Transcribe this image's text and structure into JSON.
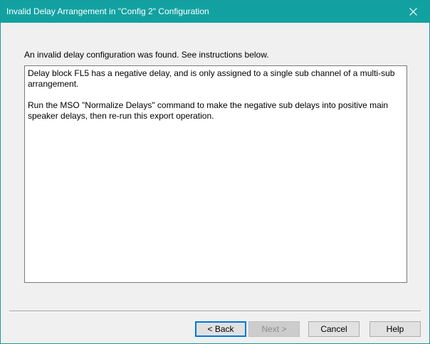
{
  "window": {
    "title": "Invalid Delay Arrangement in \"Config 2\" Configuration",
    "close_icon": "close-icon",
    "accent_color": "#12a1a1"
  },
  "main": {
    "instruction": "An invalid delay configuration was found.  See instructions below.",
    "message": {
      "paragraph1": "Delay block FL5 has a negative delay, and is only assigned to a single sub channel of a multi-sub arrangement.",
      "paragraph2": "Run the MSO \"Normalize Delays\" command to make the negative sub delays into positive main speaker delays, then re-run this export operation."
    }
  },
  "buttons": {
    "back_label": "< Back",
    "next_label": "Next >",
    "next_enabled": false,
    "cancel_label": "Cancel",
    "help_label": "Help"
  }
}
